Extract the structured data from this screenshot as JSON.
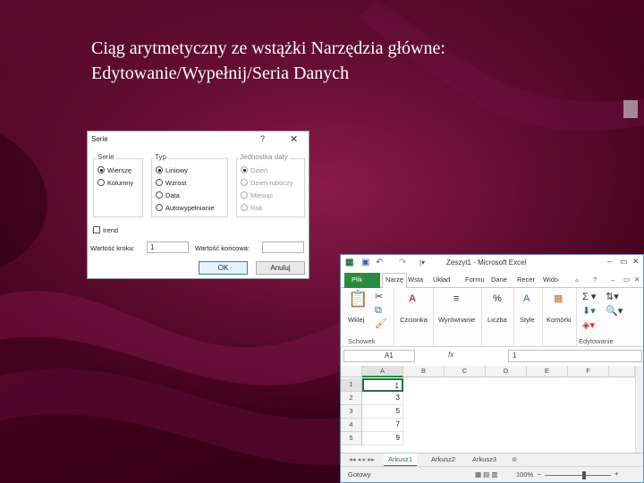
{
  "slide": {
    "title_line1": "Ciąg arytmetyczny ze wstążki Narzędzia główne:",
    "title_line2": "Edytowanie/Wypełnij/Seria Danych"
  },
  "dialog": {
    "title": "Serie",
    "help": "?",
    "close": "✕",
    "series_group": {
      "label": "Serie",
      "options": [
        {
          "label": "Wierszę",
          "selected": true
        },
        {
          "label": "Kolumny",
          "selected": false
        }
      ]
    },
    "type_group": {
      "label": "Typ",
      "options": [
        {
          "label": "Liniowy",
          "selected": true
        },
        {
          "label": "Wzrost",
          "selected": false
        },
        {
          "label": "Data",
          "selected": false
        },
        {
          "label": "Autowypełnianie",
          "selected": false
        }
      ]
    },
    "date_unit_group": {
      "label": "Jednostka daty",
      "options": [
        {
          "label": "Dzień",
          "selected": true
        },
        {
          "label": "Dzień roboczy",
          "selected": false
        },
        {
          "label": "Miesiąc",
          "selected": false
        },
        {
          "label": "Rok",
          "selected": false
        }
      ]
    },
    "trend_label": "Irend",
    "step_label": "Wartość kroku:",
    "step_value": "1",
    "stop_label": "Wartość końcowa:",
    "stop_value": "",
    "ok_label": "OK",
    "cancel_label": "Anuluj"
  },
  "excel": {
    "window_title": "Zeszyt1 - Microsoft Excel",
    "qat_icons": [
      "excel-logo-icon",
      "save-icon",
      "undo-icon",
      "redo-icon",
      "customize-icon"
    ],
    "tabs": [
      "Plik",
      "Narzę",
      "Wsta",
      "Układ",
      "Formu",
      "Dane",
      "Recer",
      "Wido"
    ],
    "ribbon": {
      "paste_label": "Wklej",
      "clipboard_label": "Schowek",
      "font_label": "Czcionka",
      "alignment_label": "Wyrównanie",
      "number_label": "Liczba",
      "styles_label": "Style",
      "cells_label": "Komórki",
      "editing_label": "Edytowanie"
    },
    "name_box": "A1",
    "fx_label": "fx",
    "formula_value": "1",
    "columns": [
      "A",
      "B",
      "C",
      "D",
      "E",
      "F"
    ],
    "rows": [
      {
        "num": "1",
        "a": "1"
      },
      {
        "num": "2",
        "a": "3"
      },
      {
        "num": "3",
        "a": "5"
      },
      {
        "num": "4",
        "a": "7"
      },
      {
        "num": "5",
        "a": "9"
      }
    ],
    "sheets": [
      "Arkusz1",
      "Arkusz2",
      "Arkusz3"
    ],
    "status": "Gotowy",
    "zoom": "100%",
    "colors": {
      "accent": "#217346",
      "file_tab": "#2a8a3e"
    }
  }
}
